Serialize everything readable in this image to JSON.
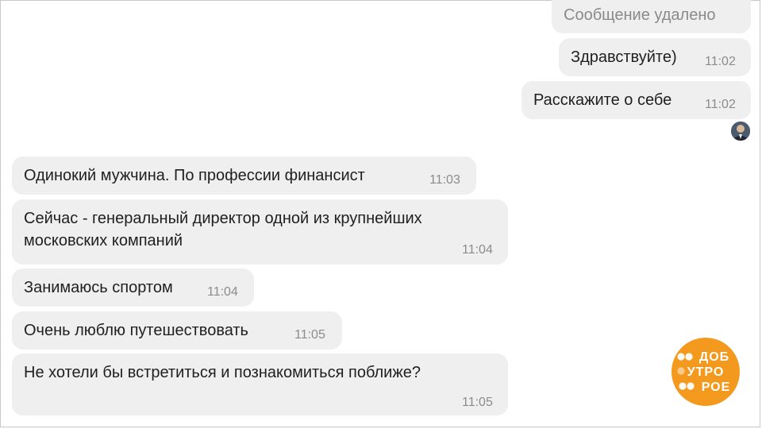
{
  "outgoing": [
    {
      "text": "Сообщение удалено",
      "time": "",
      "deleted": true
    },
    {
      "text": "Здравствуйте)",
      "time": "11:02"
    },
    {
      "text": "Расскажите о себе",
      "time": "11:02"
    }
  ],
  "incoming": [
    {
      "text": "Одинокий мужчина. По профессии финансист",
      "time": "11:03"
    },
    {
      "line1": "Сейчас - генеральный директор одной из крупнейших",
      "line2": "московских компаний",
      "time": "11:04"
    },
    {
      "text": "Занимаюсь спортом",
      "time": "11:04"
    },
    {
      "text": "Очень люблю путешествовать",
      "time": "11:05"
    },
    {
      "text": "Не хотели бы встретиться и познакомиться поближе?",
      "time": "11:05"
    }
  ],
  "logo": {
    "row1": "ДОБ",
    "row2": "УТРО",
    "row3": "РОЕ",
    "color": "#f39a1e"
  },
  "colors": {
    "bubble": "#efefef",
    "time": "#8c8c8c",
    "text": "#1f1f1f"
  }
}
